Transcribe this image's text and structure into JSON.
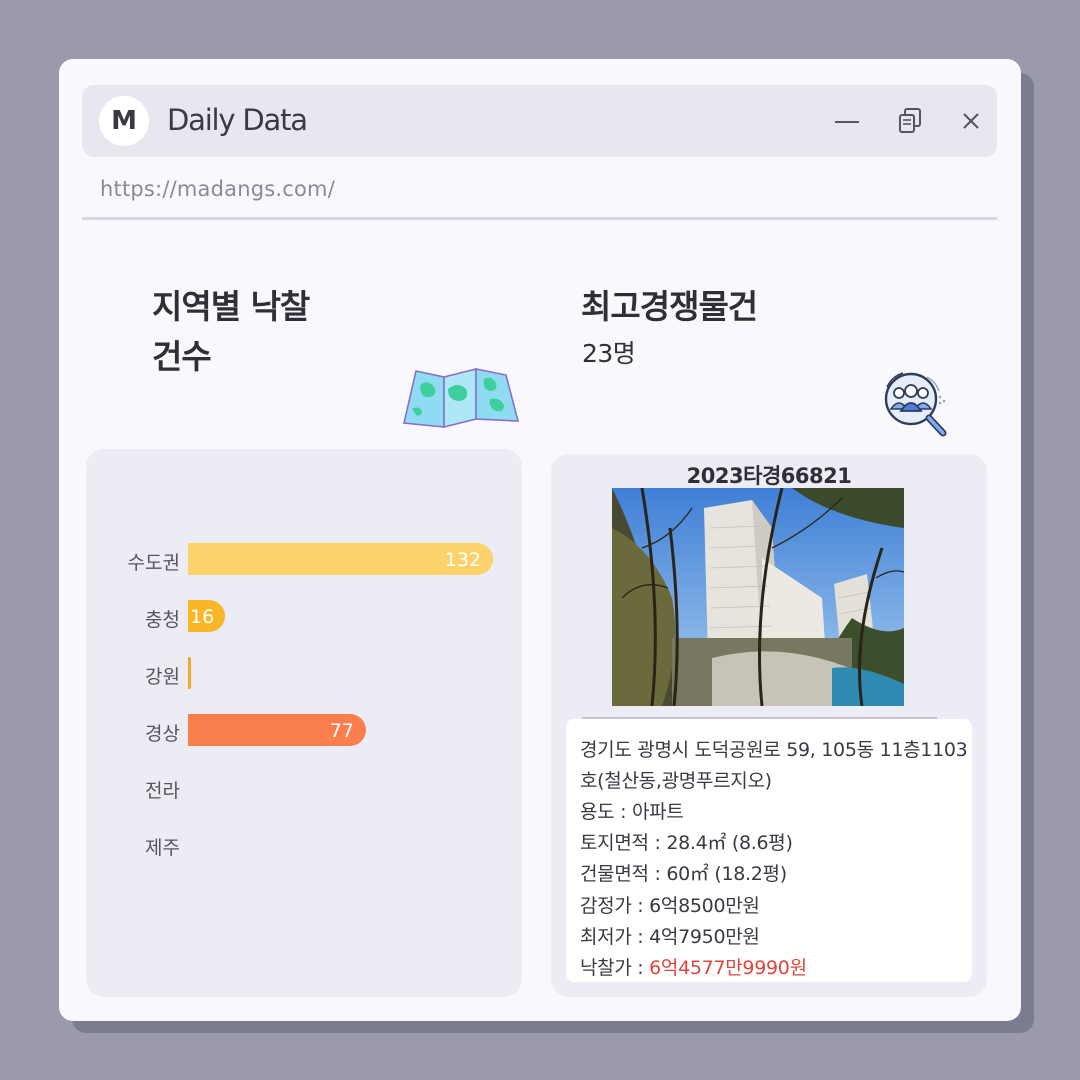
{
  "window": {
    "logo_letter": "M",
    "title": "Daily Data",
    "url": "https://madangs.com/"
  },
  "left_section": {
    "title_line1": "지역별 낙찰",
    "title_line2": "건수"
  },
  "right_section": {
    "title": "최고경쟁물건",
    "count": "23명"
  },
  "chart_data": {
    "type": "bar",
    "orientation": "horizontal",
    "categories": [
      "수도권",
      "충청",
      "강원",
      "경상",
      "전라",
      "제주"
    ],
    "values": [
      132,
      16,
      1,
      77,
      0,
      0
    ],
    "value_labels": [
      "132",
      "16",
      "",
      "77",
      "",
      ""
    ],
    "colors": [
      "#fdd26a",
      "#f9b726",
      "#f3a72c",
      "#fb7f4e",
      "#cccccc",
      "#cccccc"
    ],
    "xlim": [
      0,
      132
    ]
  },
  "property": {
    "case_number": "2023타경66821",
    "address_line1": "경기도 광명시 도덕공원로 59, 105동 11층1103",
    "address_line2": "호(철산동,광명푸르지오)",
    "usage_label": "용도 : ",
    "usage_value": "아파트",
    "land_label": "토지면적 : ",
    "land_value": "28.4㎡ (8.6평)",
    "building_label": "건물면적 : ",
    "building_value": "60㎡ (18.2평)",
    "appraisal_label": "감정가 : ",
    "appraisal_value": "6억8500만원",
    "minimum_label": "최저가 : ",
    "minimum_value": "4억7950만원",
    "winning_label": "낙찰가 : ",
    "winning_value": "6억4577만9990원"
  },
  "colors": {
    "accent_red": "#e0453a",
    "background": "#9a9aab",
    "window": "#f8f8fd"
  },
  "icons": {
    "map": "map-icon",
    "search_people": "search-people-icon",
    "minimize": "minimize-icon",
    "restore": "restore-icon",
    "close": "close-icon"
  }
}
